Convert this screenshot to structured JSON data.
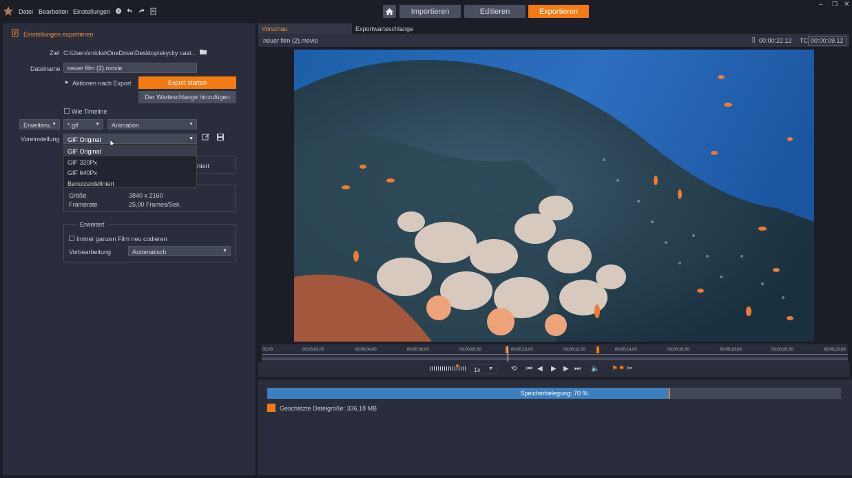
{
  "menubar": {
    "items": [
      "Datei",
      "Bearbeiten",
      "Einstellungen"
    ],
    "modes": [
      {
        "label": "Importieren",
        "active": false
      },
      {
        "label": "Editieren",
        "active": false
      },
      {
        "label": "Exportieren",
        "active": true
      }
    ]
  },
  "export_settings": {
    "title": "Einstellungen exportieren",
    "ziel_label": "Ziel",
    "ziel_value": "C:\\Users\\micke\\OneDrive\\Desktop\\skycity cast...",
    "dateiname_label": "Dateiname",
    "dateiname_value": "neuer film (2).movie",
    "aktionen_label": "Aktionen nach Export",
    "export_start_label": "Export starten",
    "queue_add_label": "Der Warteschlange hinzufügen",
    "wie_timeline_label": "Wie Timeline",
    "mode_select": "Erweiteru...",
    "format_select": "*.gif",
    "type_select": "Animation",
    "voreinstellung_label": "Voreinstellung",
    "voreinstellung_value": "GIF Original",
    "preset_options": [
      "GIF Original",
      "GIF 320Px",
      "GIF 640Px",
      "Benutzerdefiniert"
    ],
    "hidden_text_fragment": "rtiert",
    "groesse_label": "Größe",
    "groesse_value": "3840 x 2160",
    "framerate_label": "Framerate",
    "framerate_value": "25,00 Frames/Sek.",
    "erweitert_label": "Erweitert",
    "neu_codieren_label": "Immer ganzen Film neu codieren",
    "vorbearbeitung_label": "Vorbearbeitung",
    "vorbearbeitung_value": "Automatisch"
  },
  "preview": {
    "tab_preview": "Vorschau",
    "tab_queue": "Exportwarteschlange",
    "filename": "neuer film (2).movie",
    "duration": "00:00:22.12",
    "tc_label": "TC",
    "timecode": "00:00:09.12",
    "timeline_ticks": [
      "00,00",
      "00;00;02,00",
      "00;00;04,00",
      "00;00;06,00",
      "00;00;08,00",
      "00;00;10,00",
      "00;00;12,00",
      "00;00;14,00",
      "00;00;16,00",
      "00;00;18,00",
      "00;00;20,00",
      "00;00;22,00"
    ],
    "speed": "1x"
  },
  "storage": {
    "label": "Speicherbelegung: 70 %",
    "percent": 70,
    "filesize_label": "Geschätzte Dateigröße: 336,18 MB"
  },
  "colors": {
    "accent": "#f47a13",
    "storage_fill": "#3e7fc0"
  }
}
